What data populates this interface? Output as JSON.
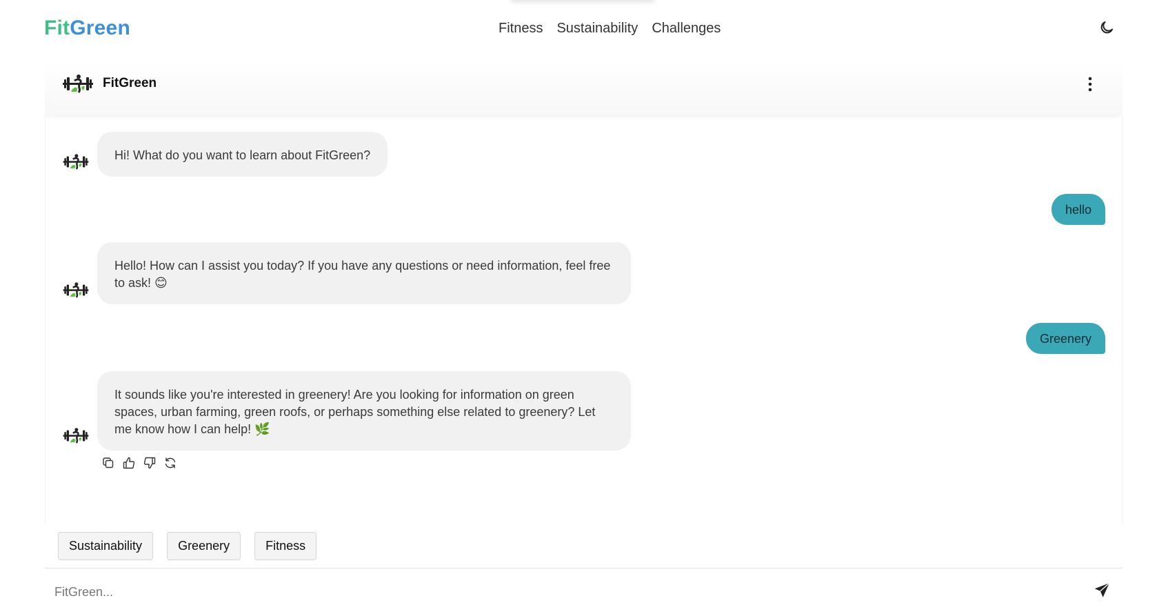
{
  "brand": {
    "part1": "Fit",
    "part2": "Green",
    "color1": "#3dbf86",
    "color2": "#3f8fd8"
  },
  "nav": {
    "links": [
      "Fitness",
      "Sustainability",
      "Challenges"
    ],
    "theme_icon": "moon-icon"
  },
  "chat": {
    "title": "FitGreen",
    "menu_icon": "more-vertical-icon",
    "messages": [
      {
        "role": "bot",
        "text": "Hi! What do you want to learn about FitGreen?"
      },
      {
        "role": "user",
        "text": "hello"
      },
      {
        "role": "bot",
        "text": "Hello! How can I assist you today? If you have any questions or need information, feel free to ask! 😊"
      },
      {
        "role": "user",
        "text": "Greenery"
      },
      {
        "role": "bot",
        "text": "It sounds like you're interested in greenery! Are you looking for information on green spaces, urban farming, green roofs, or perhaps something else related to greenery? Let me know how I can help! 🌿"
      }
    ],
    "message_actions": [
      "copy-icon",
      "thumbs-up-icon",
      "thumbs-down-icon",
      "regenerate-icon"
    ],
    "user_bubble_color": "#3aa8b6",
    "bot_bubble_color": "#f1f1f2"
  },
  "suggestions": [
    "Sustainability",
    "Greenery",
    "Fitness"
  ],
  "input": {
    "placeholder": "FitGreen...",
    "value": "",
    "send_icon": "send-icon"
  }
}
